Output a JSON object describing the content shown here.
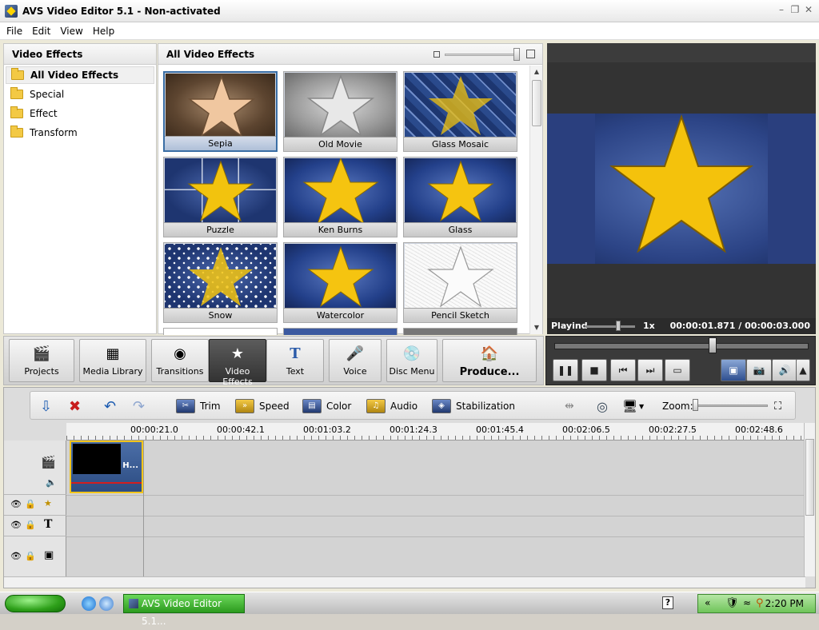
{
  "window": {
    "title": "AVS Video Editor 5.1 - Non-activated"
  },
  "menu": [
    "File",
    "Edit",
    "View",
    "Help"
  ],
  "left_panel": {
    "title": "Video Effects",
    "items": [
      {
        "label": "All Video Effects",
        "selected": true
      },
      {
        "label": "Special"
      },
      {
        "label": "Effect"
      },
      {
        "label": "Transform"
      }
    ]
  },
  "center_panel": {
    "title": "All Video Effects",
    "effects": [
      {
        "label": "Sepia",
        "selected": true
      },
      {
        "label": "Old Movie"
      },
      {
        "label": "Glass Mosaic"
      },
      {
        "label": "Puzzle"
      },
      {
        "label": "Ken Burns"
      },
      {
        "label": "Glass"
      },
      {
        "label": "Snow"
      },
      {
        "label": "Watercolor"
      },
      {
        "label": "Pencil Sketch"
      }
    ]
  },
  "preview": {
    "status": "Playind",
    "speed": "1x",
    "time": "00:00:01.871  /  00:00:03.000"
  },
  "tabs": [
    {
      "label": "Projects",
      "icon": "clapper-icon"
    },
    {
      "label": "Media Library",
      "icon": "film-grid-icon"
    },
    {
      "label": "Transitions",
      "icon": "swirl-icon"
    },
    {
      "label": "Video Effects",
      "icon": "star-clapper-icon",
      "active": true
    },
    {
      "label": "Text",
      "icon": "text-t-icon"
    },
    {
      "label": "Voice",
      "icon": "microphone-icon"
    },
    {
      "label": "Disc Menu",
      "icon": "disc-icon"
    },
    {
      "label": "Produce...",
      "icon": "house-icon"
    }
  ],
  "timeline_toolbar": {
    "trim": "Trim",
    "speed": "Speed",
    "color": "Color",
    "audio": "Audio",
    "stabilization": "Stabilization",
    "zoom": "Zoom:"
  },
  "ruler": [
    "00:00:21.0",
    "00:00:42.1",
    "00:01:03.2",
    "00:01:24.3",
    "00:01:45.4",
    "00:02:06.5",
    "00:02:27.5",
    "00:02:48.6"
  ],
  "clip": {
    "name": "H..."
  },
  "taskbar": {
    "task": "AVS Video Editor 5.1...",
    "clock": "2:20 PM"
  }
}
